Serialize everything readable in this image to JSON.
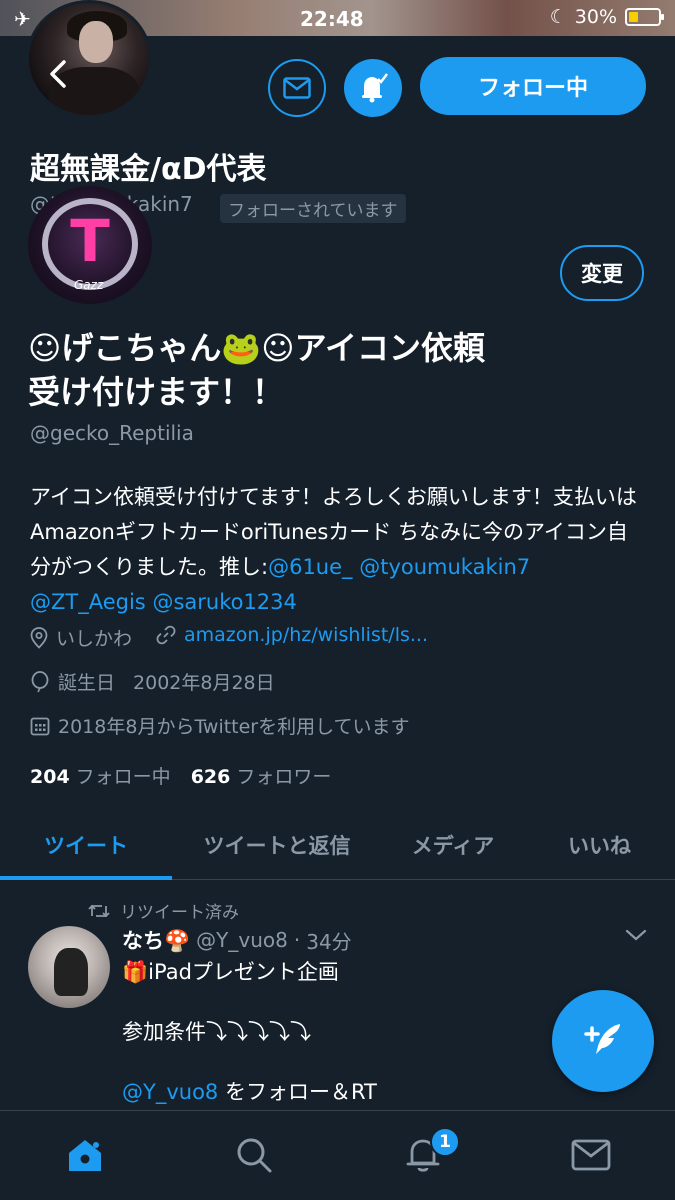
{
  "status_bar": {
    "time": "22:48",
    "battery_percent": "30%",
    "icons": [
      "airplane-icon",
      "moon-icon",
      "battery-icon"
    ]
  },
  "header": {
    "back_glyph": "<",
    "follow_button_label": "フォロー中",
    "display_name": "超無課金/αD代表",
    "handle": "@tyoumukakin7",
    "followed_badge": "フォローされています"
  },
  "profile": {
    "name_line1": "☺︎げこちゃん🐸☺︎アイコン依頼",
    "name_line2": "受け付けます！！",
    "handle": "@gecko_Reptilia",
    "edit_button_label": "変更",
    "avatar_lettering": "Gazz",
    "bio_text": "アイコン依頼受け付けてます！よろしくお願いします！支払いはAmazonギフトカードoriTunesカード ちなみに今のアイコン自分がつくりました。推し:",
    "bio_mentions": [
      "@61ue_",
      "@tyoumukakin7",
      "@ZT_Aegis",
      "@saruko1234"
    ],
    "location": "いしかわ",
    "website": "amazon.jp/hz/wishlist/ls...",
    "birthday_label": "誕生日",
    "birthday": "2002年8月28日",
    "joined": "2018年8月からTwitterを利用しています",
    "following_count": "204",
    "following_label": "フォロー中",
    "followers_count": "626",
    "followers_label": "フォロワー"
  },
  "tabs": [
    {
      "label": "ツイート",
      "active": true
    },
    {
      "label": "ツイートと返信",
      "active": false
    },
    {
      "label": "メディア",
      "active": false
    },
    {
      "label": "いいね",
      "active": false
    }
  ],
  "tweet": {
    "retweet_label": "リツイート済み",
    "author_name": "なち🍄",
    "author_handle": "@Y_vuo8",
    "separator": "·",
    "time": "34分",
    "line1": "🎁iPadプレゼント企画",
    "line2": "参加条件⤵︎⤵︎⤵︎⤵︎⤵︎",
    "line3_mention": "@Y_vuo8",
    "line3_text": " をフォロー＆RT"
  },
  "bottom_nav": {
    "items": [
      "home-icon",
      "search-icon",
      "notifications-icon",
      "messages-icon"
    ],
    "notification_badge": "1"
  },
  "colors": {
    "background": "#15202b",
    "accent": "#1d9bf0",
    "secondary_text": "#8b98a5",
    "divider": "#38444d"
  }
}
